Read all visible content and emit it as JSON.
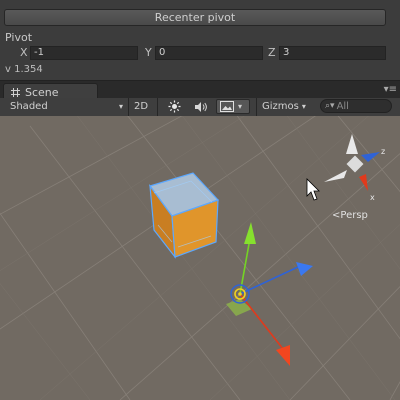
{
  "inspector": {
    "recenter_label": "Recenter pivot",
    "pivot_label": "Pivot",
    "pivot": {
      "x_label": "X",
      "x_value": "-1",
      "y_label": "Y",
      "y_value": "0",
      "z_label": "Z",
      "z_value": "3"
    },
    "version": "v 1.354"
  },
  "scene_tab": {
    "icon": "grid-icon",
    "label": "Scene"
  },
  "toolbar": {
    "shading_mode": "Shaded",
    "mode_2d": "2D",
    "gizmos_label": "Gizmos",
    "search_placeholder": "All"
  },
  "view": {
    "projection_label": "Persp",
    "axis_x": "x",
    "axis_z": "z"
  },
  "colors": {
    "panel": "#3c3c3c",
    "scene_bg": "#716a62",
    "cube_orange": "#e0952b",
    "selection_blue": "#5ca8ff",
    "axis_x_red": "#e03a1c",
    "axis_y_green": "#74d424",
    "axis_z_blue": "#2f63d6"
  }
}
